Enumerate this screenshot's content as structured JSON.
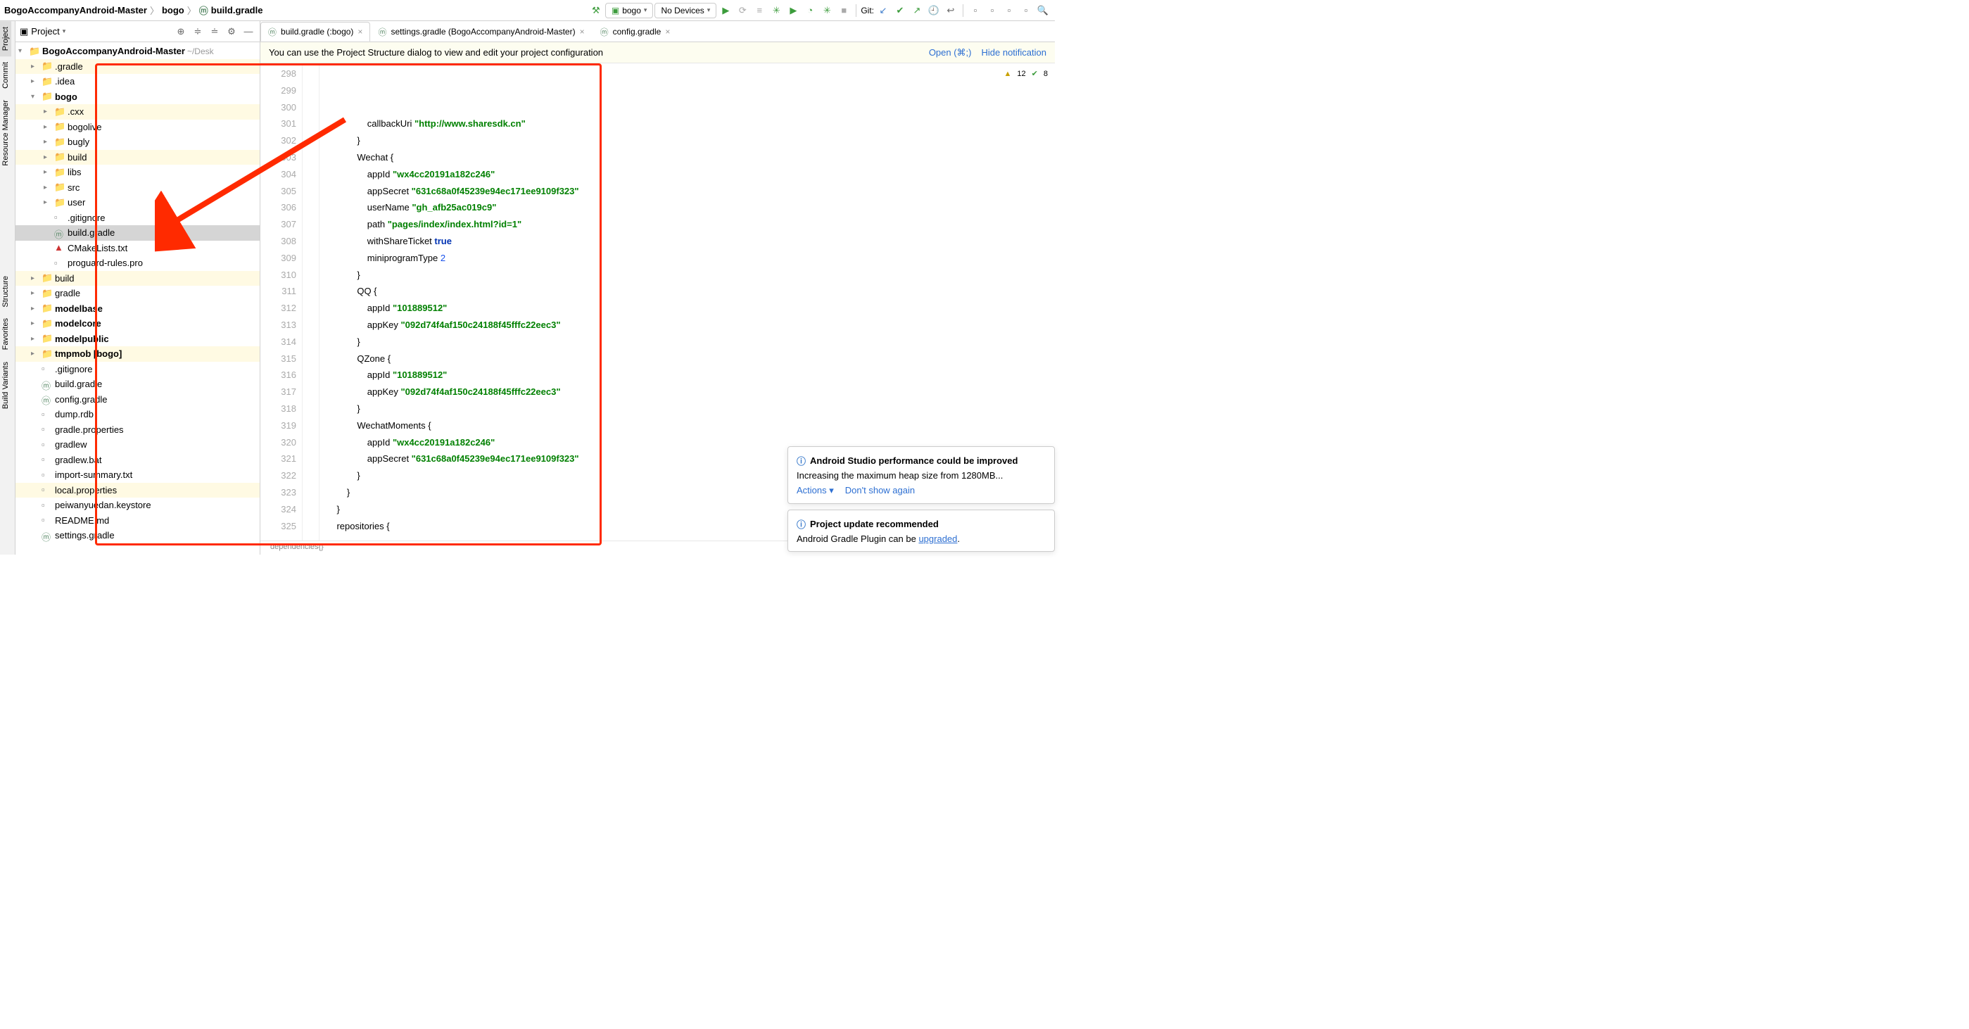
{
  "breadcrumb": {
    "root": "BogoAccompanyAndroid-Master",
    "mod": "bogo",
    "file": "build.gradle"
  },
  "runConfig": {
    "name": "bogo",
    "devices": "No Devices"
  },
  "git": {
    "label": "Git:"
  },
  "projectPanel": {
    "title": "Project"
  },
  "tree": {
    "root": "BogoAccompanyAndroid-Master",
    "rootHint": "~/Desk",
    "items": [
      {
        "lbl": ".gradle",
        "depth": 1,
        "exp": false,
        "hl": true,
        "ico": "folder-tan"
      },
      {
        "lbl": ".idea",
        "depth": 1,
        "exp": false,
        "hl": false,
        "ico": "folder-grey"
      },
      {
        "lbl": "bogo",
        "depth": 1,
        "exp": true,
        "hl": false,
        "ico": "folder-grey",
        "bold": true
      },
      {
        "lbl": ".cxx",
        "depth": 2,
        "exp": false,
        "hl": true,
        "ico": "folder-tan"
      },
      {
        "lbl": "bogolive",
        "depth": 2,
        "exp": false,
        "hl": false,
        "ico": "folder-grey"
      },
      {
        "lbl": "bugly",
        "depth": 2,
        "exp": false,
        "hl": false,
        "ico": "folder-grey"
      },
      {
        "lbl": "build",
        "depth": 2,
        "exp": false,
        "hl": true,
        "ico": "folder-tan"
      },
      {
        "lbl": "libs",
        "depth": 2,
        "exp": false,
        "hl": false,
        "ico": "folder-grey"
      },
      {
        "lbl": "src",
        "depth": 2,
        "exp": false,
        "hl": false,
        "ico": "folder-grey"
      },
      {
        "lbl": "user",
        "depth": 2,
        "exp": false,
        "hl": false,
        "ico": "folder-grey"
      },
      {
        "lbl": ".gitignore",
        "depth": 2,
        "file": true,
        "ico": "file-grey"
      },
      {
        "lbl": "build.gradle",
        "depth": 2,
        "file": true,
        "sel": true,
        "ico": "gradle-c"
      },
      {
        "lbl": "CMakeLists.txt",
        "depth": 2,
        "file": true,
        "ico": "cmake"
      },
      {
        "lbl": "proguard-rules.pro",
        "depth": 2,
        "file": true,
        "ico": "file-grey"
      },
      {
        "lbl": "build",
        "depth": 1,
        "exp": false,
        "hl": true,
        "ico": "folder-tan"
      },
      {
        "lbl": "gradle",
        "depth": 1,
        "exp": false,
        "hl": false,
        "ico": "folder-grey"
      },
      {
        "lbl": "modelbase",
        "depth": 1,
        "exp": false,
        "hl": false,
        "ico": "folder-grey",
        "bold": true
      },
      {
        "lbl": "modelcore",
        "depth": 1,
        "exp": false,
        "hl": false,
        "ico": "folder-grey",
        "bold": true
      },
      {
        "lbl": "modelpublic",
        "depth": 1,
        "exp": false,
        "hl": false,
        "ico": "folder-grey",
        "bold": true
      },
      {
        "lbl": "tmpmob [bogo]",
        "depth": 1,
        "exp": false,
        "hl": true,
        "ico": "folder-green",
        "bold": true
      },
      {
        "lbl": ".gitignore",
        "depth": 1,
        "file": true,
        "ico": "file-grey"
      },
      {
        "lbl": "build.gradle",
        "depth": 1,
        "file": true,
        "ico": "gradle-c"
      },
      {
        "lbl": "config.gradle",
        "depth": 1,
        "file": true,
        "ico": "gradle-c"
      },
      {
        "lbl": "dump.rdb",
        "depth": 1,
        "file": true,
        "ico": "file-grey"
      },
      {
        "lbl": "gradle.properties",
        "depth": 1,
        "file": true,
        "ico": "file-grey"
      },
      {
        "lbl": "gradlew",
        "depth": 1,
        "file": true,
        "ico": "file-grey"
      },
      {
        "lbl": "gradlew.bat",
        "depth": 1,
        "file": true,
        "ico": "file-grey"
      },
      {
        "lbl": "import-summary.txt",
        "depth": 1,
        "file": true,
        "ico": "file-grey"
      },
      {
        "lbl": "local.properties",
        "depth": 1,
        "file": true,
        "hl": true,
        "ico": "file-grey"
      },
      {
        "lbl": "peiwanyuedan.keystore",
        "depth": 1,
        "file": true,
        "ico": "file-grey"
      },
      {
        "lbl": "README.md",
        "depth": 1,
        "file": true,
        "ico": "file-grey"
      },
      {
        "lbl": "settings.gradle",
        "depth": 1,
        "file": true,
        "ico": "gradle-c"
      }
    ]
  },
  "tabs": [
    {
      "label": "build.gradle (:bogo)",
      "active": true
    },
    {
      "label": "settings.gradle (BogoAccompanyAndroid-Master)",
      "active": false
    },
    {
      "label": "config.gradle",
      "active": false
    }
  ],
  "banner": {
    "text": "You can use the Project Structure dialog to view and edit your project configuration",
    "open": "Open (⌘;)",
    "hide": "Hide notification"
  },
  "code": {
    "startLine": 298,
    "lines": [
      {
        "indent": 16,
        "tokens": [
          [
            "callbackUri ",
            ""
          ],
          [
            "\"http://www.sharesdk.cn\"",
            "str"
          ]
        ]
      },
      {
        "indent": 12,
        "tokens": [
          [
            "}",
            ""
          ]
        ]
      },
      {
        "indent": 12,
        "tokens": [
          [
            "Wechat {",
            ""
          ]
        ]
      },
      {
        "indent": 16,
        "tokens": [
          [
            "appId ",
            ""
          ],
          [
            "\"wx4cc20191a182c246\"",
            "str"
          ]
        ]
      },
      {
        "indent": 16,
        "tokens": [
          [
            "appSecret ",
            ""
          ],
          [
            "\"631c68a0f45239e94ec171ee9109f323\"",
            "str"
          ]
        ]
      },
      {
        "indent": 16,
        "tokens": [
          [
            "userName ",
            ""
          ],
          [
            "\"gh_afb25ac019c9\"",
            "str"
          ]
        ]
      },
      {
        "indent": 16,
        "tokens": [
          [
            "path ",
            ""
          ],
          [
            "\"pages/index/index.html?id=1\"",
            "str"
          ]
        ]
      },
      {
        "indent": 16,
        "tokens": [
          [
            "withShareTicket ",
            ""
          ],
          [
            "true",
            "kw"
          ]
        ]
      },
      {
        "indent": 16,
        "tokens": [
          [
            "miniprogramType ",
            ""
          ],
          [
            "2",
            "num"
          ]
        ]
      },
      {
        "indent": 12,
        "tokens": [
          [
            "}",
            ""
          ]
        ]
      },
      {
        "indent": 12,
        "tokens": [
          [
            "QQ {",
            ""
          ]
        ]
      },
      {
        "indent": 16,
        "tokens": [
          [
            "appId ",
            ""
          ],
          [
            "\"101889512\"",
            "str"
          ]
        ]
      },
      {
        "indent": 16,
        "tokens": [
          [
            "appKey ",
            ""
          ],
          [
            "\"092d74f4af150c24188f45fffc22eec3\"",
            "str"
          ]
        ]
      },
      {
        "indent": 12,
        "tokens": [
          [
            "}",
            ""
          ]
        ]
      },
      {
        "indent": 12,
        "tokens": [
          [
            "QZone {",
            ""
          ]
        ]
      },
      {
        "indent": 16,
        "tokens": [
          [
            "appId ",
            ""
          ],
          [
            "\"101889512\"",
            "str"
          ]
        ]
      },
      {
        "indent": 16,
        "tokens": [
          [
            "appKey ",
            ""
          ],
          [
            "\"092d74f4af150c24188f45fffc22eec3\"",
            "str"
          ]
        ]
      },
      {
        "indent": 12,
        "tokens": [
          [
            "}",
            ""
          ]
        ]
      },
      {
        "indent": 0,
        "tokens": [
          [
            "",
            ""
          ]
        ]
      },
      {
        "indent": 12,
        "tokens": [
          [
            "WechatMoments {",
            ""
          ]
        ]
      },
      {
        "indent": 16,
        "tokens": [
          [
            "appId ",
            ""
          ],
          [
            "\"wx4cc20191a182c246\"",
            "str"
          ]
        ]
      },
      {
        "indent": 16,
        "tokens": [
          [
            "appSecret ",
            ""
          ],
          [
            "\"631c68a0f45239e94ec171ee9109f323\"",
            "str"
          ]
        ]
      },
      {
        "indent": 12,
        "tokens": [
          [
            "}",
            ""
          ]
        ]
      },
      {
        "indent": 8,
        "tokens": [
          [
            "}",
            ""
          ]
        ]
      },
      {
        "indent": 4,
        "tokens": [
          [
            "}",
            ""
          ]
        ]
      },
      {
        "indent": 0,
        "tokens": [
          [
            "",
            ""
          ]
        ]
      },
      {
        "indent": 0,
        "tokens": [
          [
            "",
            ""
          ]
        ]
      },
      {
        "indent": 4,
        "tokens": [
          [
            "repositories {",
            ""
          ]
        ]
      }
    ],
    "crumb": "dependencies{}"
  },
  "inspections": {
    "warn": "12",
    "ok": "8"
  },
  "leftTabs": [
    "Project",
    "Commit",
    "Resource Manager",
    "Structure",
    "Favorites",
    "Build Variants"
  ],
  "notif1": {
    "title": "Android Studio performance could be improved",
    "body": "Increasing the maximum heap size from 1280MB...",
    "a1": "Actions",
    "a2": "Don't show again"
  },
  "notif2": {
    "title": "Project update recommended",
    "body1": "Android Gradle Plugin can be ",
    "link": "upgraded",
    "body2": "."
  }
}
